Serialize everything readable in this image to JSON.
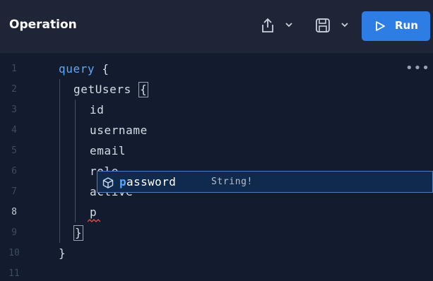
{
  "header": {
    "title": "Operation",
    "run_label": "Run",
    "icons": {
      "share": "share-icon",
      "save": "save-icon",
      "run": "play-icon",
      "more": "more-icon"
    },
    "colors": {
      "header_bg": "#1e2536",
      "run_bg": "#2d7de4"
    }
  },
  "editor": {
    "line_numbers": [
      "1",
      "2",
      "3",
      "4",
      "5",
      "6",
      "7",
      "8",
      "9",
      "10",
      "11"
    ],
    "active_line": "8",
    "lines": [
      {
        "text": "query",
        "suffix": " {"
      },
      {
        "text": "getUsers",
        "bracket": "{"
      },
      {
        "text": "id"
      },
      {
        "text": "username"
      },
      {
        "text": "email"
      },
      {
        "text": "role"
      },
      {
        "text": "active"
      },
      {
        "text": "p"
      },
      {
        "text": "}"
      },
      {
        "text": "}"
      },
      {
        "text": ""
      }
    ],
    "more_glyph": "•••"
  },
  "autocomplete": {
    "match": "p",
    "rest": "assword",
    "type": "String!",
    "icon": "field-cube-icon"
  }
}
